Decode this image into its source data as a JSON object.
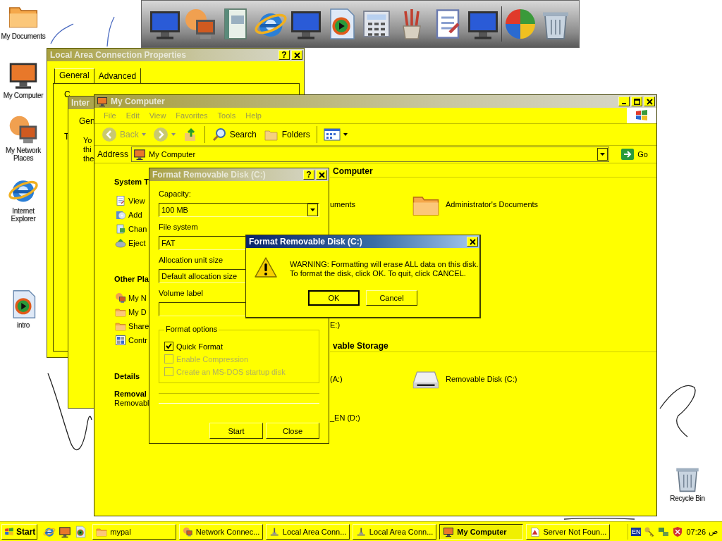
{
  "desktop_icons": [
    {
      "label": "My Documents",
      "kind": "folder"
    },
    {
      "label": "My Computer",
      "kind": "computer"
    },
    {
      "label": "My Network Places",
      "kind": "network"
    },
    {
      "label": "Internet Explorer",
      "kind": "globe"
    },
    {
      "label": "intro",
      "kind": "media"
    }
  ],
  "recycle_bin": {
    "label": "Recycle Bin"
  },
  "local_area_connection_window": {
    "title": {
      "text": "Local Area Connection Properties",
      "active": false,
      "controls": [
        {
          "kind": "help",
          "label": "?"
        },
        {
          "kind": "close"
        }
      ]
    },
    "tabs": [
      {
        "label": "General",
        "selected": true
      },
      {
        "label": "Advanced",
        "selected": false
      }
    ],
    "fragments": [
      "C",
      "T"
    ]
  },
  "back_window": {
    "title": {
      "text": "Inter",
      "active": false
    },
    "tab": "Gen",
    "lines": [
      "Yo",
      "thi",
      "the"
    ]
  },
  "my_computer_window": {
    "title": {
      "text": "My Computer",
      "active": false,
      "controls": [
        {
          "kind": "minimize"
        },
        {
          "kind": "maximize"
        },
        {
          "kind": "close"
        }
      ]
    },
    "menu": [
      "File",
      "Edit",
      "View",
      "Favorites",
      "Tools",
      "Help"
    ],
    "toolbar": [
      {
        "kind": "back",
        "label": "Back",
        "disabled": true
      },
      {
        "kind": "forward",
        "disabled": true
      },
      {
        "kind": "up"
      },
      {
        "kind": "search",
        "label": "Search"
      },
      {
        "kind": "folders",
        "label": "Folders"
      },
      {
        "kind": "views"
      }
    ],
    "address": {
      "label": "Address",
      "value": "My Computer",
      "go": "Go"
    },
    "task_pane": [
      {
        "heading": "System T",
        "items": [
          {
            "label": "View",
            "kind": "view"
          },
          {
            "label": "Add",
            "kind": "add"
          },
          {
            "label": "Chan",
            "kind": "change"
          },
          {
            "label": "Eject",
            "kind": "eject"
          }
        ]
      },
      {
        "heading": "Other Pla",
        "items": [
          {
            "label": "My N",
            "kind": "network"
          },
          {
            "label": "My D",
            "kind": "documents"
          },
          {
            "label": "Share",
            "kind": "folder"
          },
          {
            "label": "Contr",
            "kind": "control"
          }
        ]
      }
    ],
    "details": {
      "heading": "Details",
      "name": "Removal",
      "type": "Removabl"
    },
    "sections": [
      {
        "heading": "Computer",
        "items": [
          {
            "label": "uments"
          },
          {
            "label": "Administrator's Documents",
            "kind": "folder"
          }
        ]
      },
      {
        "items": [
          {
            "label": "E:)"
          }
        ]
      },
      {
        "heading": "vable Storage",
        "items": [
          {
            "label": "(A:)"
          },
          {
            "label": "Removable Disk (C:)",
            "kind": "drive"
          },
          {
            "label": "_EN (D:)"
          }
        ]
      }
    ]
  },
  "format_dialog": {
    "title": {
      "text": "Format Removable Disk (C:)",
      "active": false,
      "controls": [
        {
          "kind": "help",
          "label": "?"
        },
        {
          "kind": "close"
        }
      ]
    },
    "fields": [
      {
        "label": "Capacity:",
        "value": "100 MB",
        "kind": "dropdown"
      },
      {
        "label": "File system",
        "value": "FAT",
        "kind": "text"
      },
      {
        "label": "Allocation unit size",
        "value": "Default allocation size",
        "kind": "text"
      },
      {
        "label": "Volume label",
        "kind": "text"
      }
    ],
    "options": {
      "label": "Format options",
      "items": [
        {
          "label": "Quick Format",
          "checked": true,
          "disabled": false
        },
        {
          "label": "Enable Compression",
          "checked": false,
          "disabled": true
        },
        {
          "label": "Create an MS-DOS startup disk",
          "checked": false,
          "disabled": true
        }
      ]
    },
    "progress": {
      "level": 0
    },
    "buttons": [
      "Start",
      "Close"
    ]
  },
  "message_box": {
    "title": {
      "text": "Format Removable Disk (C:)",
      "active": true,
      "controls": [
        {
          "kind": "close"
        }
      ]
    },
    "message": [
      "WARNING: Formatting will erase ALL data on this disk.",
      "To format the disk, click OK. To quit, click CANCEL."
    ],
    "buttons": [
      {
        "label": "OK",
        "default": true
      },
      {
        "label": "Cancel",
        "default": false
      }
    ]
  },
  "taskbar": {
    "start": "Start",
    "tasks": [
      {
        "label": "mypal",
        "kind": "folder",
        "selected": false
      },
      {
        "label": "Network Connec...",
        "kind": "network",
        "selected": false
      },
      {
        "label": "Local Area Conn...",
        "kind": "plug",
        "selected": false
      },
      {
        "label": "Local Area Conn...",
        "kind": "plug",
        "selected": false
      },
      {
        "label": "My Computer",
        "kind": "computer",
        "selected": true
      },
      {
        "label": "Server Not Foun...",
        "kind": "page",
        "selected": false
      }
    ],
    "language": "EN",
    "time": "07:26",
    "time_suffix": "ص"
  }
}
